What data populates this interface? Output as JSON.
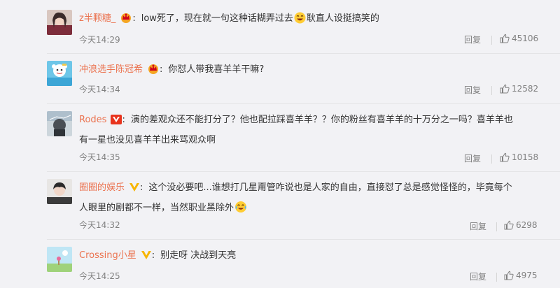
{
  "comments": [
    {
      "username": "z半颗糖_",
      "badge": "crown",
      "text_part1": "low死了，现在就一句这种话糊弄过去",
      "text_part2": "耿直人设挺搞笑的",
      "emoji": "laugh-emoji",
      "time": "今天14:29",
      "reply_label": "回复",
      "likes": "45106"
    },
    {
      "username": "冲浪选手陈冠希",
      "badge": "crown",
      "text_part1": "你怼人带我喜羊羊干嘛?",
      "time": "今天14:34",
      "reply_label": "回复",
      "likes": "12582"
    },
    {
      "username": "Rodes",
      "badge": "vip-v-red",
      "text_line1": "演的差观众还不能打分了？他也配拉踩喜羊羊？？你的粉丝有喜羊羊的十万分之一吗？喜羊羊也",
      "text_line2": "有一星也没见喜羊羊出来骂观众啊",
      "time": "今天14:35",
      "reply_label": "回复",
      "likes": "10158"
    },
    {
      "username": "圈圈的娱乐",
      "badge": "verified-v-yellow",
      "text_line1": "这个没必要吧...谁想打几星甭管咋说也是人家的自由，直接怼了总是感觉怪怪的，毕竟每个",
      "text_line2": "人眼里的剧都不一样，当然职业黑除外",
      "emoji": "cry-laugh-emoji",
      "time": "今天14:32",
      "reply_label": "回复",
      "likes": "6298"
    },
    {
      "username": "Crossing小星",
      "badge": "verified-v-yellow",
      "text_part1": "别走呀 决战到天亮",
      "time": "今天14:25",
      "reply_label": "回复",
      "likes": "4975"
    }
  ],
  "colors": {
    "username": "#eb7350",
    "text": "#333333",
    "meta": "#808080",
    "background": "#f2f2f5"
  },
  "icons": {
    "like": "thumbs-up-icon",
    "crown_badge": "crown-badge-icon",
    "vip_badge": "vip-v-icon",
    "verified_badge": "verified-v-icon"
  }
}
